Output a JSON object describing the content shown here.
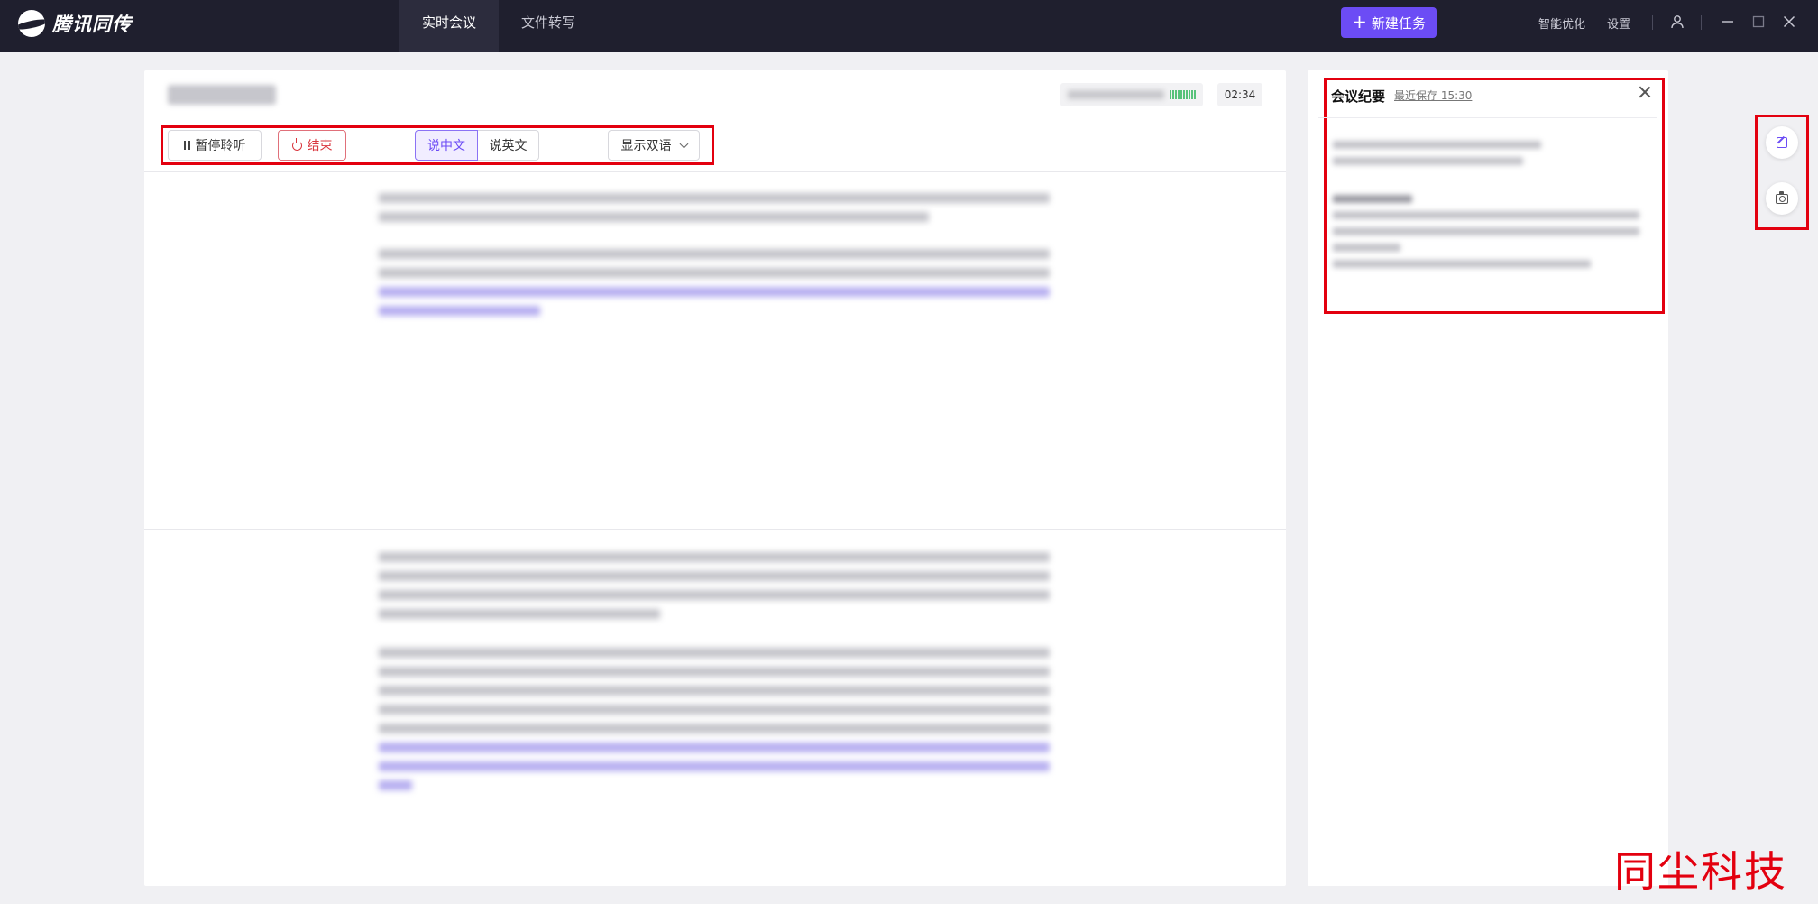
{
  "app": {
    "name": "腾讯同传"
  },
  "nav": {
    "tabs": [
      {
        "label": "实时会议",
        "active": true
      },
      {
        "label": "文件转写",
        "active": false
      }
    ]
  },
  "header": {
    "new_task_label": "新建任务",
    "smart_optimize_label": "智能优化",
    "settings_label": "设置"
  },
  "meeting": {
    "title": "████ ██████",
    "status_text": "███ ██████",
    "timer": "02:34",
    "toolbar": {
      "pause_label": "暂停聆听",
      "end_label": "结束",
      "speak_chinese_label": "说中文",
      "speak_english_label": "说英文",
      "display_mode_label": "显示双语"
    }
  },
  "minutes": {
    "title": "会议纪要",
    "saved_label": "最近保存 15:30"
  },
  "watermark": "同尘科技",
  "colors": {
    "accent": "#6c4cf5",
    "danger": "#d9363e",
    "topbar": "#1f1f2e",
    "highlight_box": "#e3000f"
  }
}
